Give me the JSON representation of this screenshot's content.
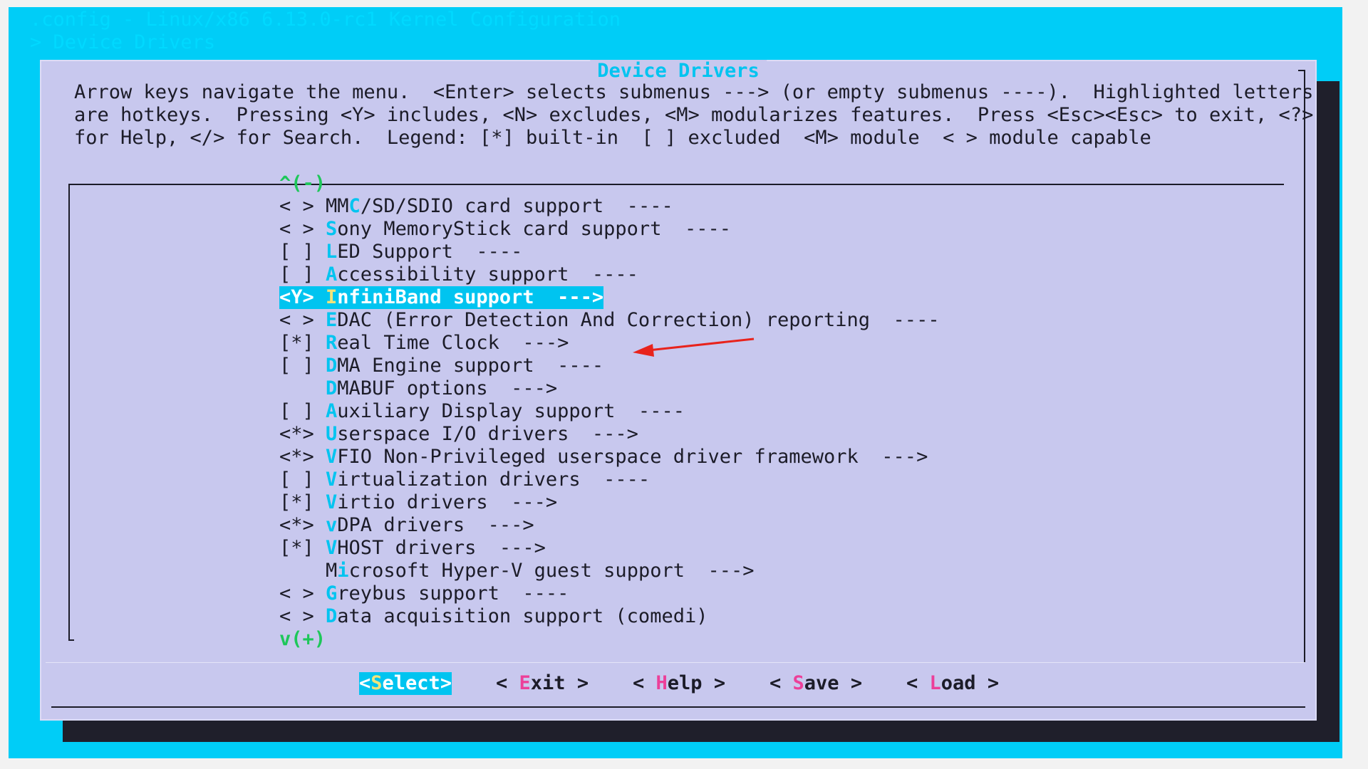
{
  "window": {
    "title_line": ".config - Linux/x86 6.13.0-rc1 Kernel Configuration",
    "breadcrumb": "> Device Drivers"
  },
  "dialog": {
    "title": "Device Drivers",
    "help_lines": [
      "Arrow keys navigate the menu.  <Enter> selects submenus ---> (or empty submenus ----).  Highlighted letters",
      "are hotkeys.  Pressing <Y> includes, <N> excludes, <M> modularizes features.  Press <Esc><Esc> to exit, <?>",
      "for Help, </> for Search.  Legend: [*] built-in  [ ] excluded  <M> module  < > module capable"
    ]
  },
  "menu": {
    "scroll_up": "^(-)",
    "scroll_down": "v(+)",
    "items": [
      {
        "prefix": "< > ",
        "pre": "MM",
        "hotkey": "C",
        "rest": "/SD/SDIO card support  ----"
      },
      {
        "prefix": "< > ",
        "pre": "",
        "hotkey": "S",
        "rest": "ony MemoryStick card support  ----"
      },
      {
        "prefix": "[ ] ",
        "pre": "",
        "hotkey": "L",
        "rest": "ED Support  ----"
      },
      {
        "prefix": "[ ] ",
        "pre": "",
        "hotkey": "A",
        "rest": "ccessibility support  ----"
      },
      {
        "prefix": "<Y> ",
        "pre": "",
        "hotkey": "I",
        "rest": "nfiniBand support  --->"
      },
      {
        "prefix": "< > ",
        "pre": "",
        "hotkey": "E",
        "rest": "DAC (Error Detection And Correction) reporting  ----"
      },
      {
        "prefix": "[*] ",
        "pre": "",
        "hotkey": "R",
        "rest": "eal Time Clock  --->"
      },
      {
        "prefix": "[ ] ",
        "pre": "",
        "hotkey": "D",
        "rest": "MA Engine support  ----"
      },
      {
        "prefix": "    ",
        "pre": "",
        "hotkey": "D",
        "rest": "MABUF options  --->"
      },
      {
        "prefix": "[ ] ",
        "pre": "",
        "hotkey": "A",
        "rest": "uxiliary Display support  ----"
      },
      {
        "prefix": "<*> ",
        "pre": "",
        "hotkey": "U",
        "rest": "serspace I/O drivers  --->"
      },
      {
        "prefix": "<*> ",
        "pre": "",
        "hotkey": "V",
        "rest": "FIO Non-Privileged userspace driver framework  --->"
      },
      {
        "prefix": "[ ] ",
        "pre": "",
        "hotkey": "V",
        "rest": "irtualization drivers  ----"
      },
      {
        "prefix": "[*] ",
        "pre": "",
        "hotkey": "V",
        "rest": "irtio drivers  --->"
      },
      {
        "prefix": "<*> ",
        "pre": "",
        "hotkey": "v",
        "rest": "DPA drivers  --->"
      },
      {
        "prefix": "[*] ",
        "pre": "",
        "hotkey": "V",
        "rest": "HOST drivers  --->"
      },
      {
        "prefix": "    ",
        "pre": "M",
        "hotkey": "i",
        "rest": "crosoft Hyper-V guest support  --->"
      },
      {
        "prefix": "< > ",
        "pre": "",
        "hotkey": "G",
        "rest": "reybus support  ----"
      },
      {
        "prefix": "< > ",
        "pre": "",
        "hotkey": "D",
        "rest": "ata acquisition support (comedi)"
      }
    ],
    "selected_index": 4
  },
  "buttons": {
    "select": {
      "open": "<",
      "hotkey": "S",
      "rest": "elect",
      "close": ">"
    },
    "exit": {
      "open": "< ",
      "hotkey": "E",
      "rest": "xit",
      "close": " >"
    },
    "help": {
      "open": "< ",
      "hotkey": "H",
      "rest": "elp",
      "close": " >"
    },
    "save": {
      "open": "< ",
      "hotkey": "S",
      "rest": "ave",
      "close": " >"
    },
    "load": {
      "open": "< ",
      "hotkey": "L",
      "rest": "oad",
      "close": " >"
    }
  },
  "colors": {
    "terminal_bg": "#00cdf7",
    "dialog_bg": "#c8c8ee",
    "highlight": "#00c4f0",
    "hotkey_button": "#ec3f99",
    "scroll_indicator": "#1ec75a",
    "annotation_arrow": "#e8231c"
  },
  "annotation": {
    "icon": "red-arrow-icon"
  }
}
